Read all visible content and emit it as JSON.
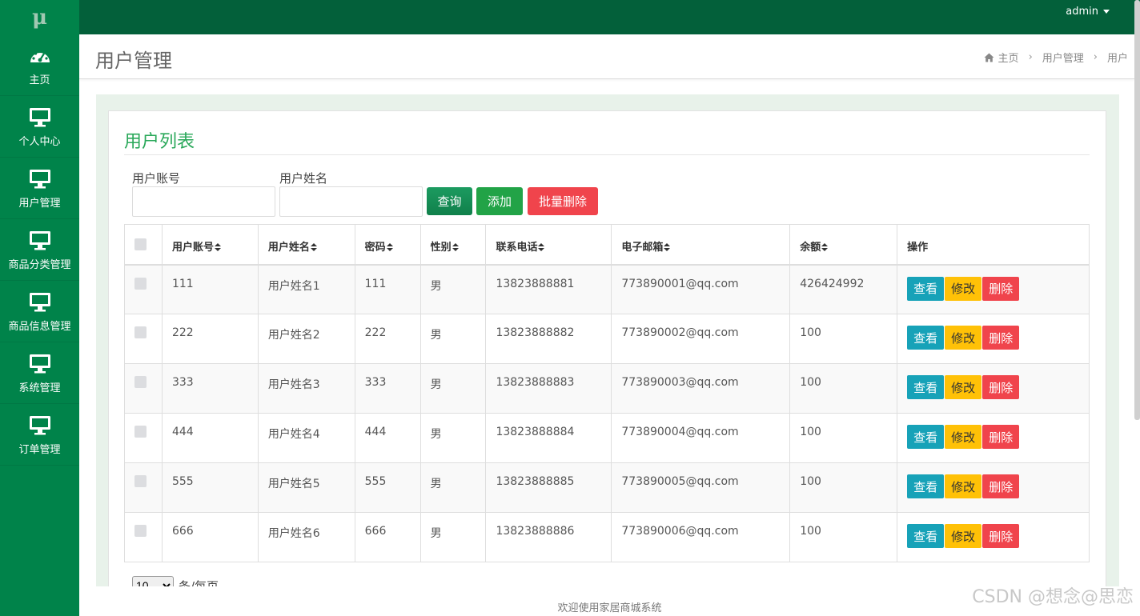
{
  "app": {
    "logo": "μ"
  },
  "sidebar": {
    "items": [
      {
        "label": "主页",
        "icon": "dashboard-icon"
      },
      {
        "label": "个人中心",
        "icon": "monitor-icon"
      },
      {
        "label": "用户管理",
        "icon": "monitor-icon"
      },
      {
        "label": "商品分类管理",
        "icon": "monitor-icon"
      },
      {
        "label": "商品信息管理",
        "icon": "monitor-icon"
      },
      {
        "label": "系统管理",
        "icon": "monitor-icon"
      },
      {
        "label": "订单管理",
        "icon": "monitor-icon"
      }
    ]
  },
  "topbar": {
    "username": "admin"
  },
  "header": {
    "title": "用户管理",
    "breadcrumb": [
      "主页",
      "用户管理",
      "用户"
    ]
  },
  "card": {
    "title": "用户列表"
  },
  "search": {
    "account_label": "用户账号",
    "account_value": "",
    "name_label": "用户姓名",
    "name_value": "",
    "query_button": "查询",
    "add_button": "添加",
    "batch_delete_button": "批量删除"
  },
  "table": {
    "columns": [
      "用户账号",
      "用户姓名",
      "密码",
      "性别",
      "联系电话",
      "电子邮箱",
      "余额",
      "操作"
    ],
    "rows": [
      {
        "account": "111",
        "name": "用户姓名1",
        "password": "111",
        "gender": "男",
        "phone": "13823888881",
        "email": "773890001@qq.com",
        "balance": "426424992"
      },
      {
        "account": "222",
        "name": "用户姓名2",
        "password": "222",
        "gender": "男",
        "phone": "13823888882",
        "email": "773890002@qq.com",
        "balance": "100"
      },
      {
        "account": "333",
        "name": "用户姓名3",
        "password": "333",
        "gender": "男",
        "phone": "13823888883",
        "email": "773890003@qq.com",
        "balance": "100"
      },
      {
        "account": "444",
        "name": "用户姓名4",
        "password": "444",
        "gender": "男",
        "phone": "13823888884",
        "email": "773890004@qq.com",
        "balance": "100"
      },
      {
        "account": "555",
        "name": "用户姓名5",
        "password": "555",
        "gender": "男",
        "phone": "13823888885",
        "email": "773890005@qq.com",
        "balance": "100"
      },
      {
        "account": "666",
        "name": "用户姓名6",
        "password": "666",
        "gender": "男",
        "phone": "13823888886",
        "email": "773890006@qq.com",
        "balance": "100"
      }
    ],
    "actions": {
      "view": "查看",
      "edit": "修改",
      "delete": "删除"
    }
  },
  "pager": {
    "page_size": "10",
    "suffix": "条/每页"
  },
  "footer": {
    "text": "欢迎使用家居商城系统"
  },
  "watermark": "CSDN @想念@思恋",
  "colors": {
    "sidebar": "#00834a",
    "topbar": "#03603a",
    "title_green": "#2aa85a",
    "view": "#17a2b8",
    "edit": "#ffc107",
    "delete": "#f0444c"
  }
}
